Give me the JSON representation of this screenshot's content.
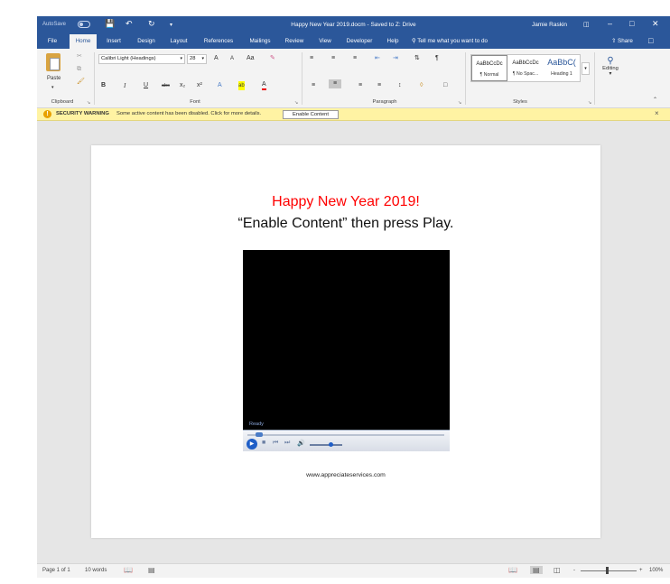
{
  "title_bar": {
    "autosave_label": "AutoSave",
    "autosave_state": "Off",
    "quick_access": {
      "save_icon": "save-icon",
      "undo_icon": "undo-icon",
      "redo_icon": "redo-icon",
      "customize_icon": "customize-qat-icon"
    },
    "document_title": "Happy New Year 2019.docm  -  Saved to Z: Drive",
    "user_name": "Jamie Raskin",
    "window_buttons": [
      "ribbon-display-options-icon",
      "minimize-icon",
      "restore-icon",
      "close-icon"
    ]
  },
  "ribbon_tabs": {
    "tabs": [
      "File",
      "Home",
      "Insert",
      "Design",
      "Layout",
      "References",
      "Mailings",
      "Review",
      "View",
      "Developer",
      "Help"
    ],
    "active_tab": "Home",
    "tell_me": "Tell me what you want to do",
    "share": "Share"
  },
  "ribbon": {
    "clipboard": {
      "group_label": "Clipboard",
      "paste_label": "Paste"
    },
    "font": {
      "group_label": "Font",
      "font_name": "Calibri Light (Headings)",
      "font_size": "28",
      "bold": "B",
      "italic": "I",
      "underline": "U",
      "strikethrough": "abc",
      "subscript": "x₂",
      "superscript": "x²",
      "grow_font": "A",
      "shrink_font": "A",
      "change_case": "Aa",
      "text_effects": "A",
      "highlight": "ab",
      "font_color": "A"
    },
    "paragraph": {
      "group_label": "Paragraph"
    },
    "styles": {
      "group_label": "Styles",
      "items": [
        {
          "sample": "AaBbCcDc",
          "name": "¶ Normal",
          "selected": true
        },
        {
          "sample": "AaBbCcDc",
          "name": "¶ No Spac...",
          "selected": false
        },
        {
          "sample": "AaBbC(",
          "name": "Heading 1",
          "selected": false
        }
      ]
    },
    "editing": {
      "label": "Editing"
    }
  },
  "security_bar": {
    "title": "SECURITY WARNING",
    "message": "Some active content has been disabled. Click for more details.",
    "button_label": "Enable Content",
    "close_glyph": "×"
  },
  "document": {
    "line1": "Happy New Year 2019!",
    "line2": "“Enable Content” then press Play.",
    "player": {
      "status": "Ready",
      "time_left": "--:--",
      "time_right": "--:--"
    },
    "url": "www.appreciateservices.com",
    "colors": {
      "line1": "#ff0000"
    }
  },
  "status_bar": {
    "page": "Page 1 of 1",
    "words": "10 words",
    "zoom": "100%",
    "zoom_minus": "-",
    "zoom_plus": "+"
  },
  "colors": {
    "accent": "#2b579a",
    "security_bar": "#fff3a3"
  }
}
